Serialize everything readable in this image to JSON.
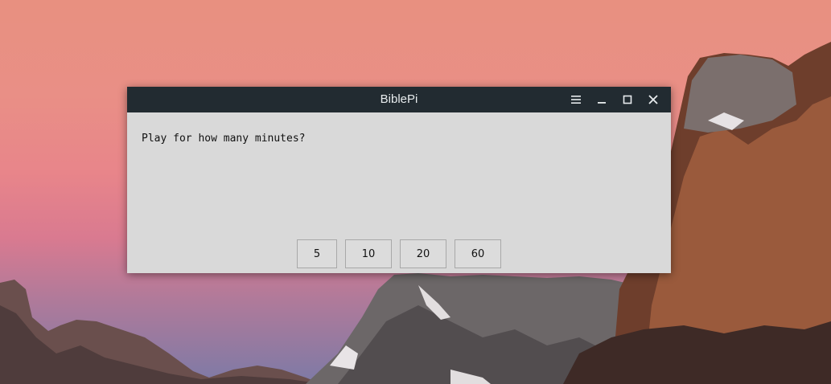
{
  "window": {
    "title": "BiblePi",
    "controls": [
      "menu-icon",
      "minimize-icon",
      "maximize-icon",
      "close-icon"
    ]
  },
  "dialog": {
    "prompt": "Play for how many minutes?",
    "options": [
      "5",
      "10",
      "20",
      "60"
    ]
  },
  "colors": {
    "titlebar": "#222b31",
    "window_body": "#d9d9d9",
    "sky_top": "#e89080",
    "sky_bottom": "#7d7aa6"
  }
}
